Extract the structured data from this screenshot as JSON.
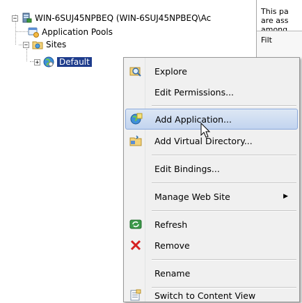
{
  "tree": {
    "server_label": "WIN-6SUJ45NPBEQ (WIN-6SUJ45NPBEQ\\Ac",
    "app_pools_label": "Application Pools",
    "sites_label": "Sites",
    "default_site_label": "Default",
    "expander_open": "−",
    "expander_closed": "+"
  },
  "right_pane": {
    "lines": [
      "This pa",
      "are ass",
      "among"
    ],
    "box_text": "Filt"
  },
  "context_menu": {
    "items": [
      {
        "label": "Explore",
        "icon": "explore-icon"
      },
      {
        "label": "Edit Permissions...",
        "icon": ""
      },
      {
        "label": "Add Application...",
        "icon": "add-application-icon"
      },
      {
        "label": "Add Virtual Directory...",
        "icon": "add-virtual-directory-icon"
      },
      {
        "label": "Edit Bindings...",
        "icon": ""
      },
      {
        "label": "Manage Web Site",
        "icon": "",
        "submenu": "▶"
      },
      {
        "label": "Refresh",
        "icon": "refresh-icon"
      },
      {
        "label": "Remove",
        "icon": "remove-icon"
      },
      {
        "label": "Rename",
        "icon": ""
      },
      {
        "label": "Switch to Content View",
        "icon": "content-view-icon"
      }
    ],
    "hovered_item": "Add Application..."
  },
  "colors": {
    "selection": "#1e3c8c",
    "hover_border": "#8aa9dc",
    "remove_red": "#d62020"
  }
}
